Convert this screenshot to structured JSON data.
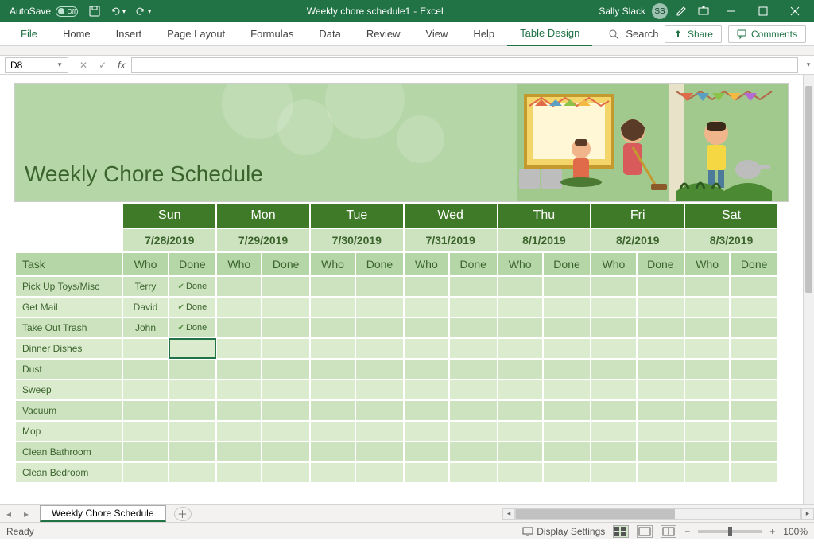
{
  "titlebar": {
    "autosave_label": "AutoSave",
    "autosave_state": "Off",
    "document": "Weekly chore schedule1",
    "app": "Excel",
    "user_name": "Sally Slack",
    "user_initials": "SS"
  },
  "ribbon": {
    "tabs": [
      "File",
      "Home",
      "Insert",
      "Page Layout",
      "Formulas",
      "Data",
      "Review",
      "View",
      "Help",
      "Table Design"
    ],
    "active_tab": "Table Design",
    "search_label": "Search",
    "share_label": "Share",
    "comments_label": "Comments"
  },
  "formula": {
    "cell_ref": "D8",
    "value": ""
  },
  "banner": {
    "title": "Weekly Chore Schedule"
  },
  "schedule": {
    "task_header": "Task",
    "who_header": "Who",
    "done_header": "Done",
    "days": [
      {
        "name": "Sun",
        "date": "7/28/2019"
      },
      {
        "name": "Mon",
        "date": "7/29/2019"
      },
      {
        "name": "Tue",
        "date": "7/30/2019"
      },
      {
        "name": "Wed",
        "date": "7/31/2019"
      },
      {
        "name": "Thu",
        "date": "8/1/2019"
      },
      {
        "name": "Fri",
        "date": "8/2/2019"
      },
      {
        "name": "Sat",
        "date": "8/3/2019"
      }
    ],
    "tasks": [
      {
        "name": "Pick Up Toys/Misc",
        "cells": [
          {
            "who": "Terry",
            "done": "Done"
          },
          {},
          {},
          {},
          {},
          {},
          {}
        ]
      },
      {
        "name": "Get Mail",
        "cells": [
          {
            "who": "David",
            "done": "Done"
          },
          {},
          {},
          {},
          {},
          {},
          {}
        ]
      },
      {
        "name": "Take Out Trash",
        "cells": [
          {
            "who": "John",
            "done": "Done"
          },
          {},
          {},
          {},
          {},
          {},
          {}
        ]
      },
      {
        "name": "Dinner Dishes",
        "cells": [
          {},
          {},
          {},
          {},
          {},
          {},
          {}
        ]
      },
      {
        "name": "Dust",
        "cells": [
          {},
          {},
          {},
          {},
          {},
          {},
          {}
        ]
      },
      {
        "name": "Sweep",
        "cells": [
          {},
          {},
          {},
          {},
          {},
          {},
          {}
        ]
      },
      {
        "name": "Vacuum",
        "cells": [
          {},
          {},
          {},
          {},
          {},
          {},
          {}
        ]
      },
      {
        "name": "Mop",
        "cells": [
          {},
          {},
          {},
          {},
          {},
          {},
          {}
        ]
      },
      {
        "name": "Clean Bathroom",
        "cells": [
          {},
          {},
          {},
          {},
          {},
          {},
          {}
        ]
      },
      {
        "name": "Clean Bedroom",
        "cells": [
          {},
          {},
          {},
          {},
          {},
          {},
          {}
        ]
      }
    ],
    "selected": {
      "task_index": 3,
      "day_index": 0,
      "col": "done"
    }
  },
  "sheet_tab": {
    "name": "Weekly Chore Schedule"
  },
  "statusbar": {
    "mode": "Ready",
    "display_settings": "Display Settings",
    "zoom": "100%"
  }
}
